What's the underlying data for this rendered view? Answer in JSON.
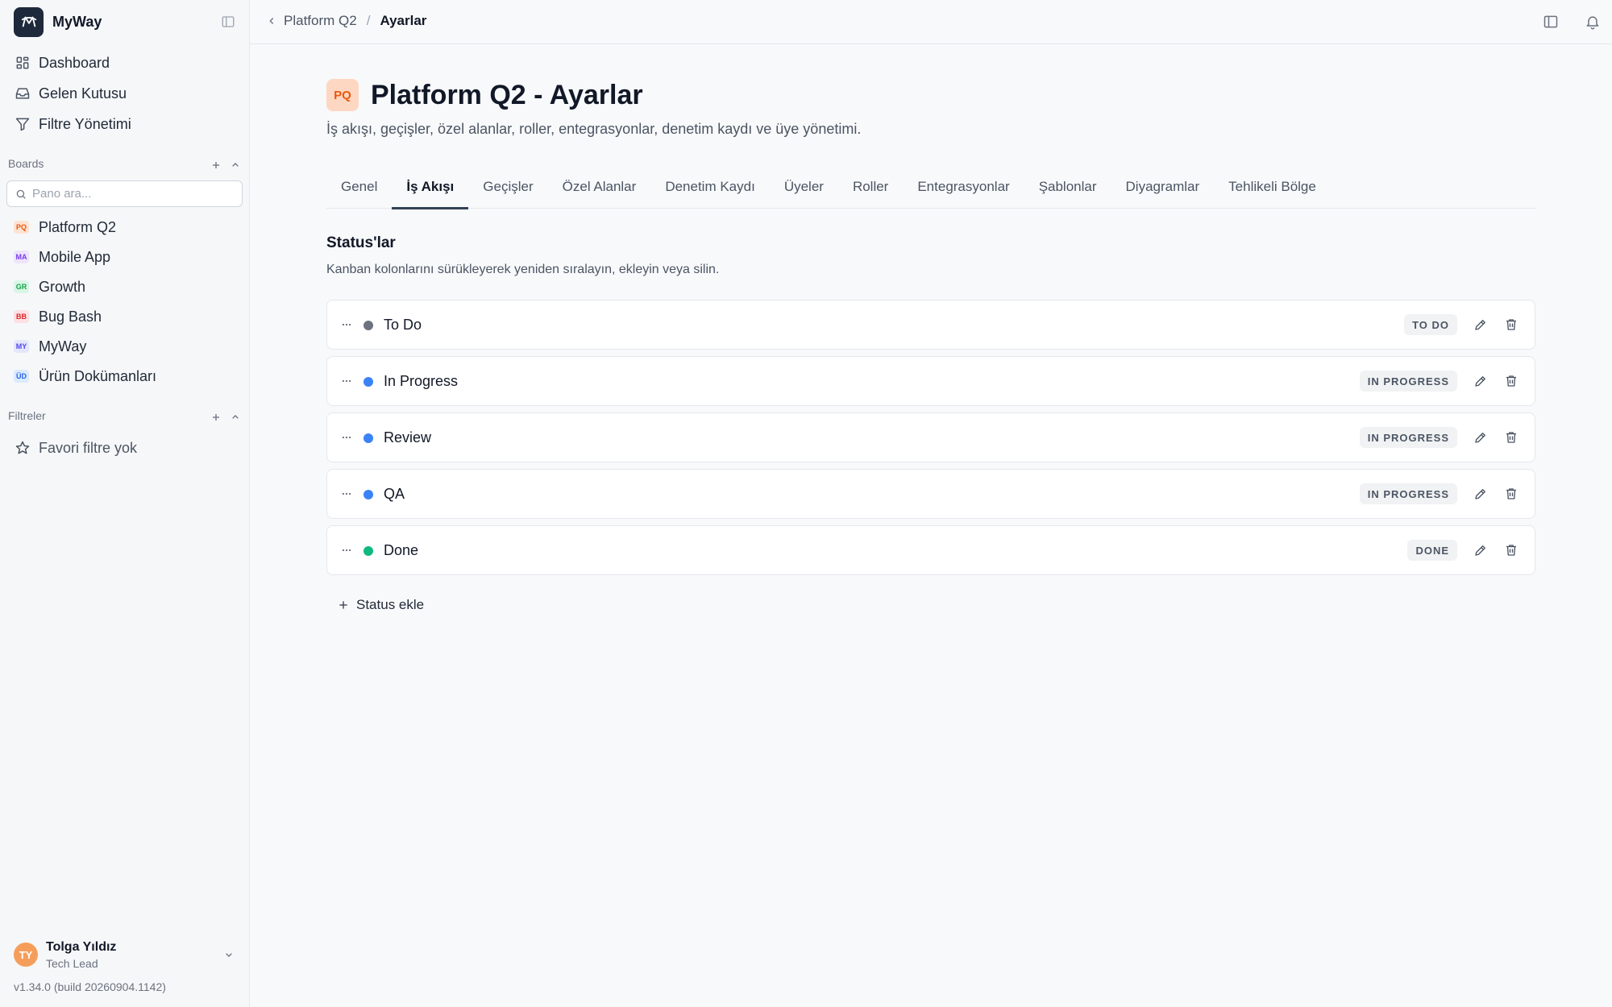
{
  "app": {
    "name": "MyWay"
  },
  "nav": [
    {
      "label": "Dashboard",
      "icon": "grid-icon"
    },
    {
      "label": "Gelen Kutusu",
      "icon": "inbox-icon"
    },
    {
      "label": "Filtre Yönetimi",
      "icon": "filter-icon"
    }
  ],
  "boards": {
    "label": "Boards",
    "search_placeholder": "Pano ara...",
    "items": [
      {
        "badge": "PQ",
        "label": "Platform Q2",
        "badge_bg": "#fde3d3",
        "badge_fg": "#ea580c"
      },
      {
        "badge": "MA",
        "label": "Mobile App",
        "badge_bg": "#ede4fb",
        "badge_fg": "#7c3aed"
      },
      {
        "badge": "GR",
        "label": "Growth",
        "badge_bg": "#d9f5e6",
        "badge_fg": "#16a34a"
      },
      {
        "badge": "BB",
        "label": "Bug Bash",
        "badge_bg": "#fde0e3",
        "badge_fg": "#dc2626"
      },
      {
        "badge": "MY",
        "label": "MyWay",
        "badge_bg": "#e4e7fb",
        "badge_fg": "#4f46e5"
      },
      {
        "badge": "ÜD",
        "label": "Ürün Dokümanları",
        "badge_bg": "#dbeafe",
        "badge_fg": "#2563eb"
      }
    ]
  },
  "filters": {
    "label": "Filtreler",
    "empty_label": "Favori filtre yok"
  },
  "user": {
    "initials": "TY",
    "name": "Tolga Yıldız",
    "role": "Tech Lead"
  },
  "version": "v1.34.0 (build 20260904.1142)",
  "breadcrumb": {
    "parent": "Platform Q2",
    "separator": "/",
    "current": "Ayarlar"
  },
  "page": {
    "badge": "PQ",
    "title": "Platform Q2 - Ayarlar",
    "subtitle": "İş akışı, geçişler, özel alanlar, roller, entegrasyonlar, denetim kaydı ve üye yönetimi."
  },
  "tabs": [
    {
      "label": "Genel",
      "active": false
    },
    {
      "label": "İş Akışı",
      "active": true
    },
    {
      "label": "Geçişler",
      "active": false
    },
    {
      "label": "Özel Alanlar",
      "active": false
    },
    {
      "label": "Denetim Kaydı",
      "active": false
    },
    {
      "label": "Üyeler",
      "active": false
    },
    {
      "label": "Roller",
      "active": false
    },
    {
      "label": "Entegrasyonlar",
      "active": false
    },
    {
      "label": "Şablonlar",
      "active": false
    },
    {
      "label": "Diyagramlar",
      "active": false
    },
    {
      "label": "Tehlikeli Bölge",
      "active": false
    }
  ],
  "statuses_section": {
    "title": "Status'lar",
    "description": "Kanban kolonlarını sürükleyerek yeniden sıralayın, ekleyin veya silin.",
    "add_label": "Status ekle"
  },
  "statuses": [
    {
      "name": "To Do",
      "category": "TO DO",
      "color": "#6b7280"
    },
    {
      "name": "In Progress",
      "category": "IN PROGRESS",
      "color": "#3b82f6"
    },
    {
      "name": "Review",
      "category": "IN PROGRESS",
      "color": "#3b82f6"
    },
    {
      "name": "QA",
      "category": "IN PROGRESS",
      "color": "#3b82f6"
    },
    {
      "name": "Done",
      "category": "DONE",
      "color": "#10b981"
    }
  ]
}
